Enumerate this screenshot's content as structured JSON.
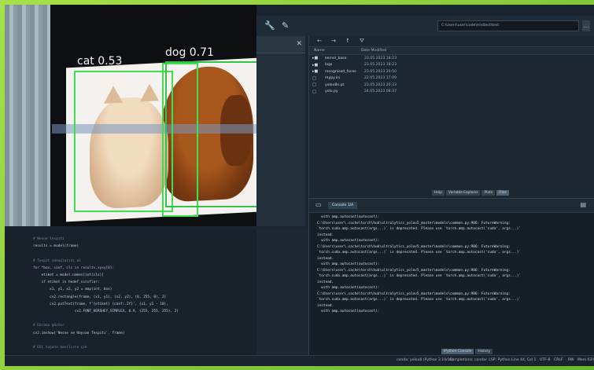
{
  "camera": {
    "detections": [
      {
        "label": "cat 0.53"
      },
      {
        "label": "dog 0.71"
      }
    ]
  },
  "toolbar": {
    "path": "C:\\Users\\user\\code\\m\\dtect\\test",
    "path_button": "…"
  },
  "files": {
    "columns": [
      "Name",
      "Date Modified"
    ],
    "rows": [
      {
        "icon": "folder-icon",
        "name": "kernel_base",
        "date": "23.05.2023 18:23"
      },
      {
        "icon": "folder-icon",
        "name": "logs",
        "date": "23.05.2023 18:23"
      },
      {
        "icon": "folder-icon",
        "name": "recognised_faces",
        "date": "23.05.2023 20:50"
      },
      {
        "icon": "file-icon",
        "name": "mypy.ini",
        "date": "22.05.2023 17:09"
      },
      {
        "icon": "file-icon",
        "name": "yolov8n.pt",
        "date": "23.05.2023 20:33"
      },
      {
        "icon": "file-icon",
        "name": "yolo.py",
        "date": "24.05.2023 08:37"
      }
    ],
    "tabs": [
      {
        "label": "Help",
        "active": false
      },
      {
        "label": "Variable Explorer",
        "active": false
      },
      {
        "label": "Plots",
        "active": false
      },
      {
        "label": "Files",
        "active": true
      }
    ]
  },
  "editor": {
    "lines": [
      {
        "text": "# Nesne tespiti",
        "kind": "comment"
      },
      {
        "text": "results = model(frame)",
        "kind": "code"
      },
      {
        "text": "",
        "kind": "code"
      },
      {
        "text": "# Tespit sonuçlarını al",
        "kind": "comment"
      },
      {
        "text": "for *box, conf, cls in results.xyxy[0]:",
        "kind": "kw"
      },
      {
        "text": "    etiket = model.names[int(cls)]",
        "kind": "code"
      },
      {
        "text": "    if etiket in hedef_sınıflar:",
        "kind": "code"
      },
      {
        "text": "        x1, y1, x2, y2 = map(int, box)",
        "kind": "code"
      },
      {
        "text": "        cv2.rectangle(frame, (x1, y1), (x2, y2), (0, 255, 0), 2)",
        "kind": "code"
      },
      {
        "text": "        cv2.putText(frame, f'{etiket} {conf:.2f}', (x1, y1 - 10),",
        "kind": "code"
      },
      {
        "text": "                    cv2.FONT_HERSHEY_SIMPLEX, 0.9, (255, 255, 255), 2)",
        "kind": "code"
      },
      {
        "text": "",
        "kind": "code"
      },
      {
        "text": "# Ekrana göster",
        "kind": "comment"
      },
      {
        "text": "cv2.imshow('Nesne ve Hayvan Tespiti', frame)",
        "kind": "code"
      },
      {
        "text": "",
        "kind": "code"
      },
      {
        "text": "# ESC tuşuna basılırsa çık",
        "kind": "comment"
      }
    ]
  },
  "console": {
    "tab_label": "Console 1/A",
    "lines": [
      "  with amp.autocast(autocast):",
      "C:\\Users\\user\\.cache\\torch\\hub\\ultralytics_yolov5_master\\models\\common.py:906: FutureWarning:",
      "`torch.cuda.amp.autocast(args...)` is deprecated. Please use `torch.amp.autocast('cuda', args...)`",
      "instead.",
      "  with amp.autocast(autocast):",
      "C:\\Users\\user\\.cache\\torch\\hub\\ultralytics_yolov5_master\\models\\common.py:906: FutureWarning:",
      "`torch.cuda.amp.autocast(args...)` is deprecated. Please use `torch.amp.autocast('cuda', args...)`",
      "instead.",
      "  with amp.autocast(autocast):",
      "C:\\Users\\user\\.cache\\torch\\hub\\ultralytics_yolov5_master\\models\\common.py:906: FutureWarning:",
      "`torch.cuda.amp.autocast(args...)` is deprecated. Please use `torch.amp.autocast('cuda', args...)`",
      "instead.",
      "  with amp.autocast(autocast):",
      "C:\\Users\\user\\.cache\\torch\\hub\\ultralytics_yolov5_master\\models\\common.py:906: FutureWarning:",
      "`torch.cuda.amp.autocast(args...)` is deprecated. Please use `torch.amp.autocast('cuda', args...)`",
      "instead.",
      "  with amp.autocast(autocast):"
    ],
    "bottom_tabs": [
      {
        "label": "IPython Console",
        "active": true
      },
      {
        "label": "History",
        "active": false
      }
    ]
  },
  "status": {
    "items": [
      "conda: yolov8 (Python 3.10.14)",
      "✓ Completions: conda",
      "✓ LSP: Python",
      "Line 44, Col 1",
      "UTF-8",
      "CRLF",
      "RW",
      "Mem 63%"
    ]
  }
}
